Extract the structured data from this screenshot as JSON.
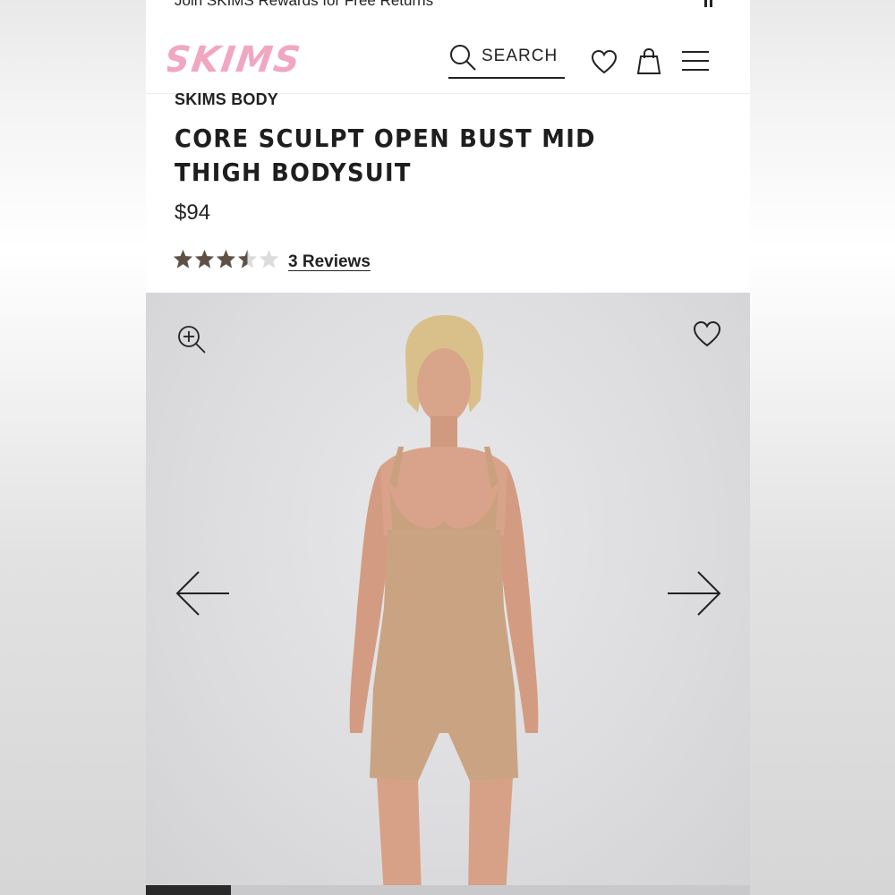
{
  "promo": {
    "text": "Join SKIMS Rewards for Free Returns",
    "pause_icon": "pause-icon"
  },
  "header": {
    "logo_text": "SKIMS",
    "search_label": "SEARCH",
    "icons": [
      "search-icon",
      "heart-icon",
      "shopping-bag-icon",
      "menu-icon"
    ]
  },
  "product": {
    "brand": "SKIMS BODY",
    "title": "CORE SCULPT OPEN BUST MID THIGH BODYSUIT",
    "price": "$94",
    "rating": 3.5,
    "rating_max": 5,
    "reviews_label": "3 Reviews"
  },
  "gallery": {
    "icons": [
      "zoom-in-icon",
      "heart-icon",
      "arrow-left-icon",
      "arrow-right-icon"
    ],
    "progress": 0.14
  },
  "colors": {
    "logo_pink": "#f0a7bf",
    "star_filled": "#5e5247",
    "star_empty": "#dcdcdc",
    "text": "#222222",
    "gallery_bg": "#dcdcde"
  }
}
